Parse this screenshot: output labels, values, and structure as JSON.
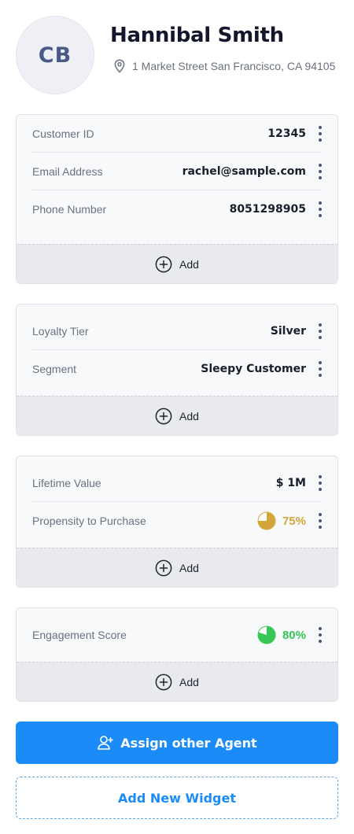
{
  "profile": {
    "initials": "CB",
    "name": "Hannibal Smith",
    "address": "1 Market Street San Francisco, CA 94105"
  },
  "icons": {
    "location": "map-pin-icon",
    "more": "kebab-menu-icon",
    "add": "plus-circle-icon",
    "assign": "add-user-icon",
    "progress": "pie-progress-icon"
  },
  "cards": {
    "identity": {
      "rows": [
        {
          "label": "Customer ID",
          "value": "12345"
        },
        {
          "label": "Email Address",
          "value": "rachel@sample.com"
        },
        {
          "label": "Phone Number",
          "value": "8051298905"
        }
      ],
      "add_label": "Add"
    },
    "loyalty": {
      "rows": [
        {
          "label": "Loyalty Tier",
          "value": "Silver"
        },
        {
          "label": "Segment",
          "value": "Sleepy Customer"
        }
      ],
      "add_label": "Add"
    },
    "value": {
      "rows": [
        {
          "label": "Lifetime Value",
          "value": "$ 1M"
        },
        {
          "label": "Propensity to Purchase",
          "value": "75%",
          "fraction": 0.75
        }
      ],
      "add_label": "Add"
    },
    "engagement": {
      "rows": [
        {
          "label": "Engagement Score",
          "value": "80%",
          "fraction": 0.8
        }
      ],
      "add_label": "Add"
    }
  },
  "colors": {
    "primary": "#1b8cf7",
    "gold": "#d4a63a",
    "green": "#36c755"
  },
  "actions": {
    "assign_label": "Assign other Agent",
    "add_widget_label": "Add New Widget"
  }
}
